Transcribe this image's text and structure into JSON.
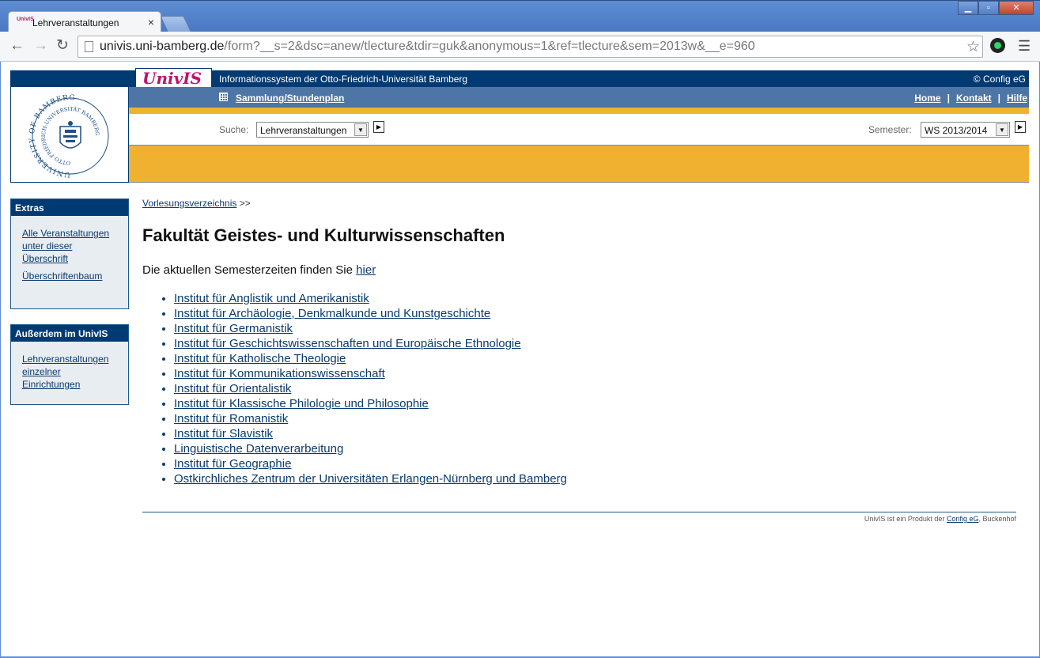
{
  "browser": {
    "tab_title": "Lehrveranstaltungen",
    "tab_favicon": "UnivIS",
    "url_host": "univis.uni-bamberg.de",
    "url_rest": "/form?__s=2&dsc=anew/tlecture&tdir=guk&anonymous=1&ref=tlecture&sem=2013w&__e=960"
  },
  "header": {
    "logo": "UnivIS",
    "info": "Informationssystem der Otto-Friedrich-Universität Bamberg",
    "copyright": "© Config eG",
    "nav_collection": "Sammlung/Stundenplan",
    "nav_home": "Home",
    "nav_contact": "Kontakt",
    "nav_help": "Hilfe",
    "search_label": "Suche:",
    "search_value": "Lehrveranstaltungen",
    "semester_label": "Semester:",
    "semester_value": "WS 2013/2014",
    "seal_outer": "UNIVERSITY OF BAMBERG",
    "seal_inner": "OTTO-FRIEDRICH-UNIVERSITÄT BAMBERG"
  },
  "sidebar": {
    "extras_title": "Extras",
    "extras_links": [
      "Alle Veranstaltungen unter dieser Überschrift",
      "Überschriftenbaum"
    ],
    "more_title": "Außerdem im UnivIS",
    "more_links": [
      "Lehrveranstaltungen einzelner Einrichtungen"
    ]
  },
  "main": {
    "breadcrumb_link": "Vorlesungsverzeichnis",
    "breadcrumb_sep": ">>",
    "title": "Fakultät Geistes- und Kulturwissenschaften",
    "intro_text": "Die aktuellen Semesterzeiten finden Sie",
    "intro_link": "hier",
    "institutes": [
      "Institut für Anglistik und Amerikanistik",
      "Institut für Archäologie, Denkmalkunde und Kunstgeschichte",
      "Institut für Germanistik",
      "Institut für Geschichtswissenschaften und Europäische Ethnologie",
      "Institut für Katholische Theologie",
      "Institut für Kommunikationswissenschaft",
      "Institut für Orientalistik",
      "Institut für Klassische Philologie und Philosophie",
      "Institut für Romanistik",
      "Institut für Slavistik",
      "Linguistische Datenverarbeitung",
      "Institut für Geographie",
      "Ostkirchliches Zentrum der Universitäten Erlangen-Nürnberg und Bamberg"
    ]
  },
  "footer": {
    "text_before": "UnivIS ist ein Produkt der",
    "link": "Config eG",
    "text_after": ", Buckenhof"
  }
}
